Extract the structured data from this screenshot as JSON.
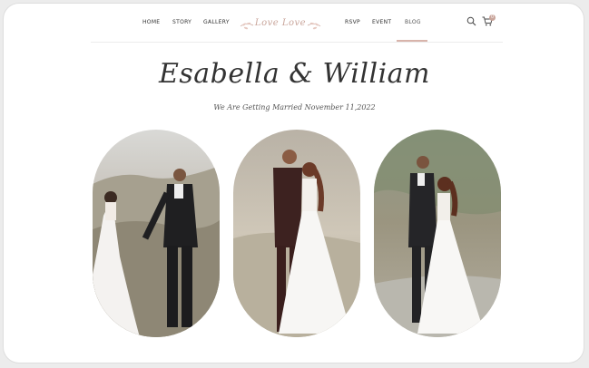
{
  "nav": {
    "left_items": [
      {
        "label": "HOME"
      },
      {
        "label": "STORY"
      },
      {
        "label": "GALLERY"
      }
    ],
    "right_items": [
      {
        "label": "RSVP"
      },
      {
        "label": "EVENT"
      },
      {
        "label": "BLOG",
        "active": true
      }
    ],
    "logo": "Love Love",
    "cart_count": "0"
  },
  "hero": {
    "title": "Esabella & William",
    "subtitle": "We Are Getting Married November 11,2022"
  },
  "colors": {
    "accent": "#d8b4ab",
    "text": "#333333",
    "background": "#ffffff"
  },
  "icons": [
    "search-icon",
    "cart-icon"
  ],
  "photos": [
    {
      "alt": "couple walking holding hands"
    },
    {
      "alt": "couple kissing"
    },
    {
      "alt": "couple posing on rocks"
    }
  ]
}
